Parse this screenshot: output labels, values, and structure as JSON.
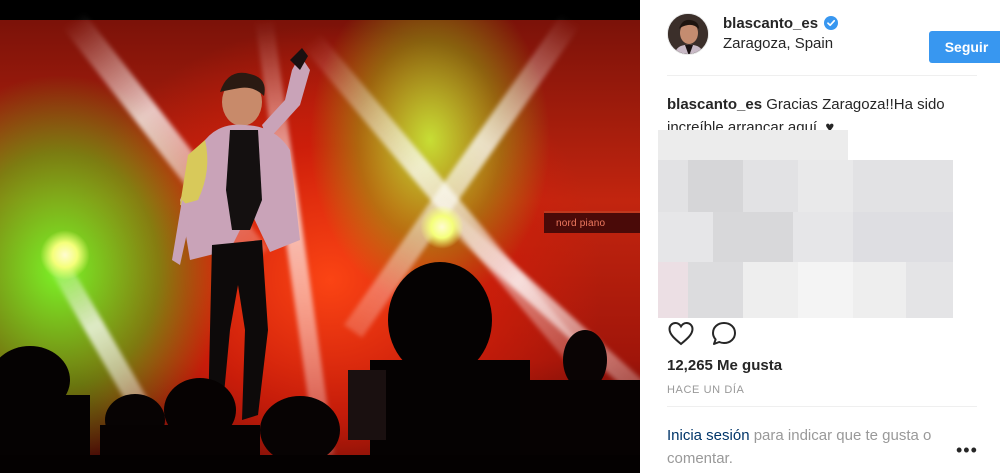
{
  "post": {
    "username": "blascanto_es",
    "location": "Zaragoza, Spain",
    "follow_label": "Seguir",
    "caption_user": "blascanto_es",
    "caption_text": "Gracias Zaragoza!!Ha sido increíble arrancar aquí. ♥",
    "likes": "12,265 Me gusta",
    "timestamp": "HACE UN DÍA",
    "login_link": "Inicia sesión",
    "login_rest": "para indicar que te gusta o comentar.",
    "more_label": "•••"
  },
  "photo": {
    "stage_sign": "nord piano"
  },
  "icons": {
    "verified": "verified-badge-icon",
    "like": "heart-icon",
    "comment": "comment-bubble-icon",
    "more": "more-options-icon"
  },
  "colors": {
    "follow_button": "#3897f0",
    "verified": "#3897f0",
    "link": "#003569",
    "muted": "#999999"
  }
}
